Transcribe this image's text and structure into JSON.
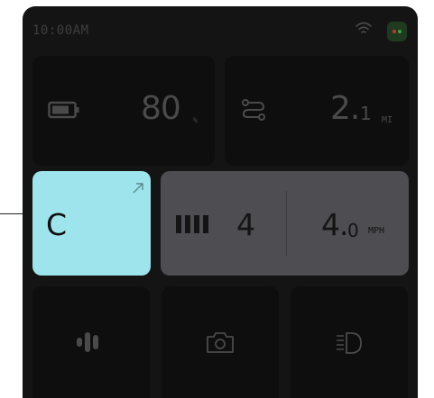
{
  "status": {
    "time": "10:00AM",
    "wifi_icon": "wifi-icon",
    "app_icon": "colored-dots-icon",
    "dot_colors": [
      "#c0392b",
      "#2e8b3a"
    ]
  },
  "battery": {
    "icon": "battery-icon",
    "value": "80",
    "unit": "%"
  },
  "trip": {
    "icon": "route-icon",
    "value_int": "2.",
    "value_dec": "1",
    "unit": "MI"
  },
  "mode": {
    "letter": "C",
    "icon": "expand-arrow-icon",
    "color": "#9ee4ec"
  },
  "ride": {
    "gear_icon": "gear-bars-icon",
    "gear": "4",
    "speed_int": "4.",
    "speed_dec": "0",
    "speed_unit": "MPH"
  },
  "buttons": [
    {
      "icon": "sound-wave-icon"
    },
    {
      "icon": "camera-icon"
    },
    {
      "icon": "headlight-icon"
    }
  ]
}
